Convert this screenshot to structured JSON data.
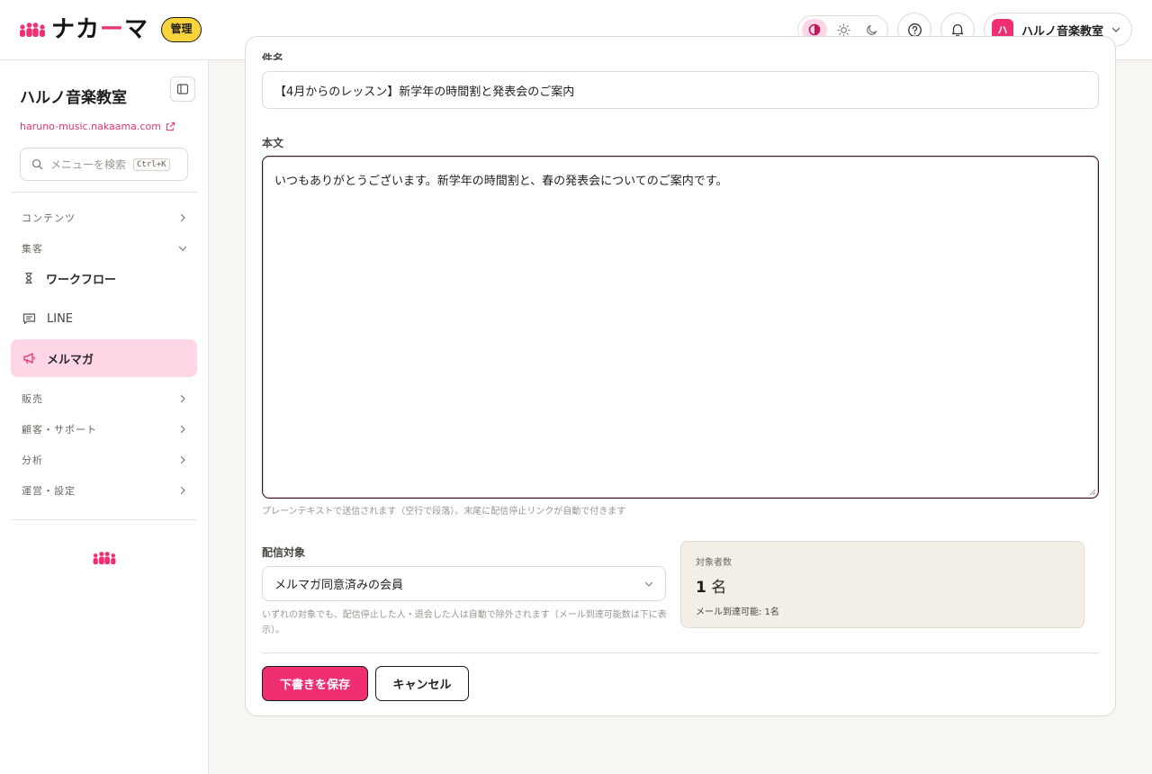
{
  "header": {
    "brand_main": "ナカ",
    "brand_accent": "ー",
    "brand_tail": "マ",
    "admin_badge": "管理",
    "account_avatar": "ハ",
    "account_name": "ハルノ音楽教室"
  },
  "sidebar": {
    "school_name": "ハルノ音楽教室",
    "site_link": "haruno-music.nakaama.com",
    "search_placeholder": "メニューを検索",
    "search_shortcut": "Ctrl+K",
    "sections": [
      {
        "label": "コンテンツ",
        "state": "collapsed"
      },
      {
        "label": "集客",
        "state": "expanded"
      },
      {
        "label": "販売",
        "state": "collapsed"
      },
      {
        "label": "顧客・サポート",
        "state": "collapsed"
      },
      {
        "label": "分析",
        "state": "collapsed"
      },
      {
        "label": "運営・設定",
        "state": "collapsed"
      }
    ],
    "items": [
      {
        "label": "ワークフロー",
        "icon": "hourglass-icon"
      },
      {
        "label": "LINE",
        "icon": "chat-icon"
      },
      {
        "label": "メルマガ",
        "icon": "megaphone-icon",
        "active": true
      }
    ]
  },
  "form": {
    "title_label": "件名",
    "title_value": "【4月からのレッスン】新学年の時間割と発表会のご案内",
    "body_label": "本文",
    "body_value": "いつもありがとうございます。新学年の時間割と、春の発表会についてのご案内です。",
    "body_help": "プレーンテキストで送信されます（空行で段落）。末尾に配信停止リンクが自動で付きます",
    "target_label": "配信対象",
    "target_value": "メルマガ同意済みの会員",
    "target_help": "いずれの対象でも、配信停止した人・退会した人は自動で除外されます（メール到達可能数は下に表示）。",
    "count_label": "対象者数",
    "count_number": "1",
    "count_unit": "名",
    "count_sub": "メール到達可能: 1名",
    "save_label": "下書きを保存",
    "cancel_label": "キャンセル"
  },
  "colors": {
    "accent": "#ef2f72",
    "accent_soft": "#ffd6e6",
    "badge_yellow": "#f8d33b"
  }
}
